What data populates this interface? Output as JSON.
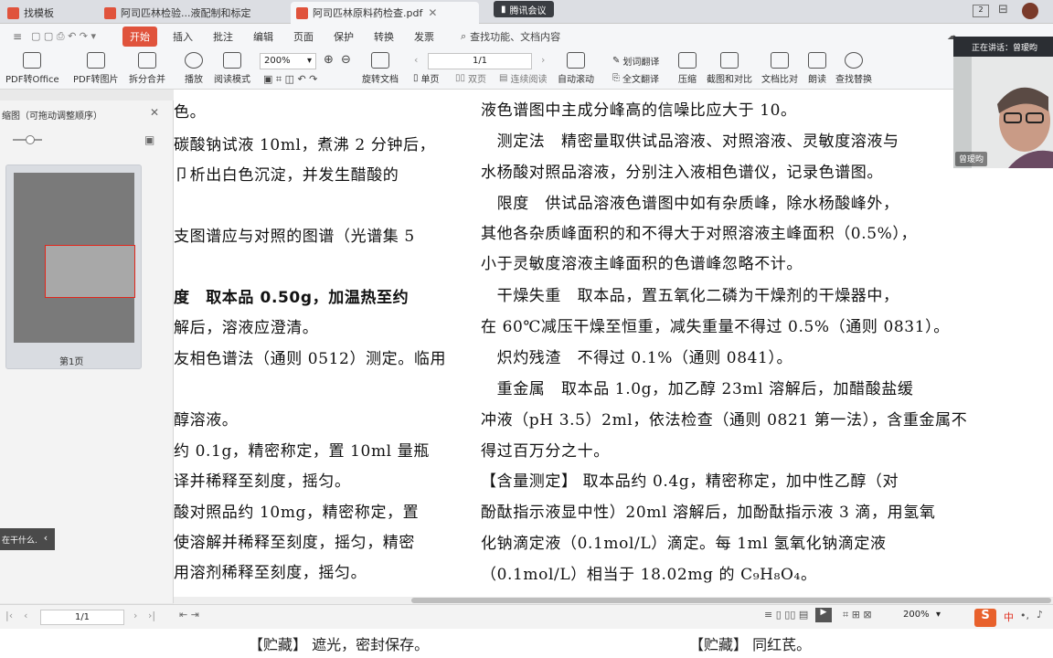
{
  "tabs": [
    {
      "label": "找模板"
    },
    {
      "label": "阿司匹林检验...液配制和标定"
    },
    {
      "label": "阿司匹林原料药检查.pdf"
    }
  ],
  "meeting": {
    "label": "腾讯会议"
  },
  "menu": {
    "items": [
      "开始",
      "插入",
      "批注",
      "编辑",
      "页面",
      "保护",
      "转换",
      "发票"
    ],
    "search_label": "查找功能、文档内容"
  },
  "toolbar": {
    "pdf_to_office": "PDF转Office",
    "pdf_to_image": "PDF转图片",
    "split_merge": "拆分合并",
    "play": "播放",
    "read_mode": "阅读模式",
    "zoom": "200%",
    "rotate": "旋转文档",
    "page": "1/1",
    "single": "单页",
    "double": "双页",
    "continuous": "连续阅读",
    "auto_scroll": "自动滚动",
    "translate_word": "划词翻译",
    "translate_full": "全文翻译",
    "compress": "压缩",
    "screenshot_compare": "截图和对比",
    "doc_compare": "文档比对",
    "read_aloud": "朗读",
    "find_replace": "查找替换"
  },
  "left_panel": {
    "title": "缩图（可拖动调整顺序）",
    "thumb_label": "第1页",
    "tip": "在干什么..."
  },
  "video": {
    "speaking": "正在讲话：曾瑷昀",
    "name": "曾瑷昀"
  },
  "doc": {
    "left_lines": [
      "色。",
      "碳酸钠试液 10ml，煮沸 2 分钟后，",
      "卩析出白色沉淀，并发生醋酸的",
      "",
      "支图谱应与对照的图谱（光谱集 5",
      "",
      "度　取本品 0.50g，加温热至约",
      "解后，溶液应澄清。",
      "友相色谱法（通则 0512）测定。临用",
      "",
      "醇溶液。",
      "约 0.1g，精密称定，置 10ml 量瓶",
      "译并稀释至刻度，摇匀。",
      "酸对照品约 10mg，精密称定，置",
      "使溶解并稀释至刻度，摇匀，精密",
      "用溶剂稀释至刻度，摇匀。"
    ],
    "right_lines": [
      "液色谱图中主成分峰高的信噪比应大于 10。",
      "　测定法　精密量取供试品溶液、对照溶液、灵敏度溶液与",
      "水杨酸对照品溶液，分别注入液相色谱仪，记录色谱图。",
      "　限度　供试品溶液色谱图中如有杂质峰，除水杨酸峰外，",
      "其他各杂质峰面积的和不得大于对照溶液主峰面积（0.5%），",
      "小于灵敏度溶液主峰面积的色谱峰忽略不计。",
      "　干燥失重　取本品，置五氧化二磷为干燥剂的干燥器中，",
      "在 60℃减压干燥至恒重，减失重量不得过 0.5%（通则 0831）。",
      "　炽灼残渣　不得过 0.1%（通则 0841）。",
      "　重金属　取本品 1.0g，加乙醇 23ml 溶解后，加醋酸盐缓",
      "冲液（pH 3.5）2ml，依法检查（通则 0821 第一法），含重金属不",
      "得过百万分之十。",
      "【含量测定】 取本品约 0.4g，精密称定，加中性乙醇（对",
      "酚酞指示液显中性）20ml 溶解后，加酚酞指示液 3 滴，用氢氧",
      "化钠滴定液（0.1mol/L）滴定。每 1ml 氢氧化钠滴定液",
      "（0.1mol/L）相当于 18.02mg 的 C₉H₈O₄。"
    ]
  },
  "status": {
    "page": "1/1",
    "zoom": "200%",
    "ime": "中"
  },
  "bottom": {
    "left": "【贮藏】 遮光，密封保存。",
    "right": "【贮藏】 同红芪。"
  }
}
